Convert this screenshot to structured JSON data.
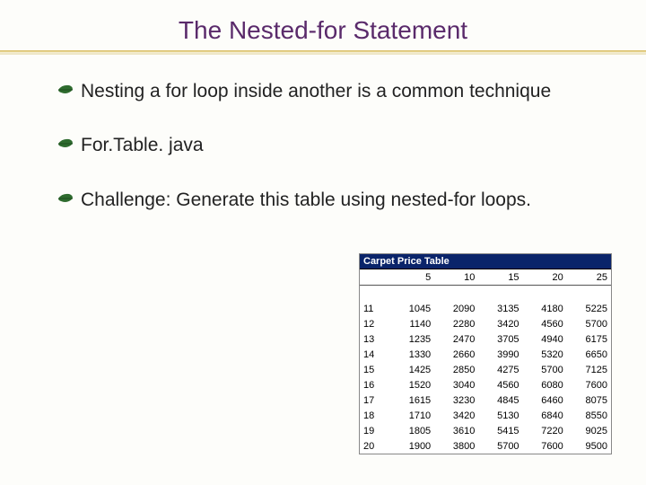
{
  "title": "The Nested-for Statement",
  "bullets": [
    "Nesting a for loop inside another is a common technique",
    "For.Table. java",
    "Challenge: Generate this table using nested-for loops."
  ],
  "table": {
    "window_title": "Carpet Price Table",
    "col_headers": [
      "5",
      "10",
      "15",
      "20",
      "25"
    ]
  },
  "chart_data": {
    "type": "table",
    "title": "Carpet Price Table",
    "row_labels": [
      11,
      12,
      13,
      14,
      15,
      16,
      17,
      18,
      19,
      20
    ],
    "col_labels": [
      5,
      10,
      15,
      20,
      25
    ],
    "values": [
      [
        1045,
        2090,
        3135,
        4180,
        5225
      ],
      [
        1140,
        2280,
        3420,
        4560,
        5700
      ],
      [
        1235,
        2470,
        3705,
        4940,
        6175
      ],
      [
        1330,
        2660,
        3990,
        5320,
        6650
      ],
      [
        1425,
        2850,
        4275,
        5700,
        7125
      ],
      [
        1520,
        3040,
        4560,
        6080,
        7600
      ],
      [
        1615,
        3230,
        4845,
        6460,
        8075
      ],
      [
        1710,
        3420,
        5130,
        6840,
        8550
      ],
      [
        1805,
        3610,
        5415,
        7220,
        9025
      ],
      [
        1900,
        3800,
        5700,
        7600,
        9500
      ]
    ]
  }
}
